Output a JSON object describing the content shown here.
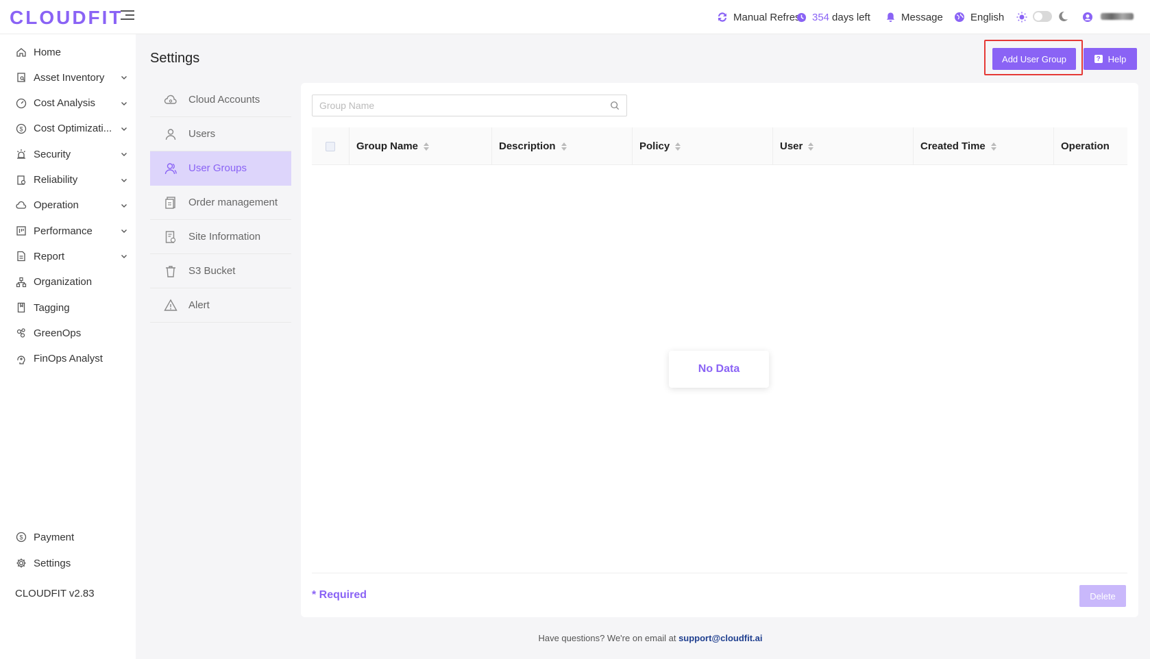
{
  "app": {
    "logo": "CLOUDFIT",
    "version": "CLOUDFIT v2.83"
  },
  "topbar": {
    "refresh_label": "Manual Refresh",
    "days_count": "354",
    "days_suffix": "days left",
    "message_label": "Message",
    "language_label": "English"
  },
  "sidebar": {
    "items": [
      {
        "label": "Home",
        "icon": "home-icon",
        "expandable": false
      },
      {
        "label": "Asset Inventory",
        "icon": "asset-icon",
        "expandable": true
      },
      {
        "label": "Cost Analysis",
        "icon": "dashboard-icon",
        "expandable": true
      },
      {
        "label": "Cost Optimizati...",
        "icon": "dollar-circle-icon",
        "expandable": true
      },
      {
        "label": "Security",
        "icon": "alarm-icon",
        "expandable": true
      },
      {
        "label": "Reliability",
        "icon": "reliability-icon",
        "expandable": true
      },
      {
        "label": "Operation",
        "icon": "cloud-icon",
        "expandable": true
      },
      {
        "label": "Performance",
        "icon": "performance-icon",
        "expandable": true
      },
      {
        "label": "Report",
        "icon": "report-icon",
        "expandable": true
      },
      {
        "label": "Organization",
        "icon": "organization-icon",
        "expandable": false
      },
      {
        "label": "Tagging",
        "icon": "tag-icon",
        "expandable": false
      },
      {
        "label": "GreenOps",
        "icon": "greenops-icon",
        "expandable": false
      },
      {
        "label": "FinOps Analyst",
        "icon": "analyst-icon",
        "expandable": false
      }
    ],
    "payment_label": "Payment",
    "settings_label": "Settings"
  },
  "page": {
    "title": "Settings",
    "add_button": "Add User Group",
    "help_button": "Help"
  },
  "submenu": {
    "items": [
      {
        "label": "Cloud Accounts",
        "icon": "cloud-account-icon",
        "active": false
      },
      {
        "label": "Users",
        "icon": "user-icon",
        "active": false
      },
      {
        "label": "User Groups",
        "icon": "user-group-icon",
        "active": true
      },
      {
        "label": "Order management",
        "icon": "order-icon",
        "active": false
      },
      {
        "label": "Site Information",
        "icon": "site-info-icon",
        "active": false
      },
      {
        "label": "S3 Bucket",
        "icon": "bucket-icon",
        "active": false
      },
      {
        "label": "Alert",
        "icon": "alert-icon",
        "active": false
      }
    ]
  },
  "table": {
    "search_placeholder": "Group Name",
    "columns": [
      {
        "label": "Group Name",
        "sortable": true
      },
      {
        "label": "Description",
        "sortable": true
      },
      {
        "label": "Policy",
        "sortable": true
      },
      {
        "label": "User",
        "sortable": true
      },
      {
        "label": "Created Time",
        "sortable": true
      },
      {
        "label": "Operation",
        "sortable": false
      }
    ],
    "rows": [],
    "empty_text": "No Data",
    "required_note": "* Required",
    "delete_button": "Delete"
  },
  "footer": {
    "text": "Have questions? We're on email at",
    "email": "support@cloudfit.ai"
  },
  "colors": {
    "accent": "#8a63f5",
    "highlight": "#e53935",
    "active_bg": "#ddd5fb"
  }
}
